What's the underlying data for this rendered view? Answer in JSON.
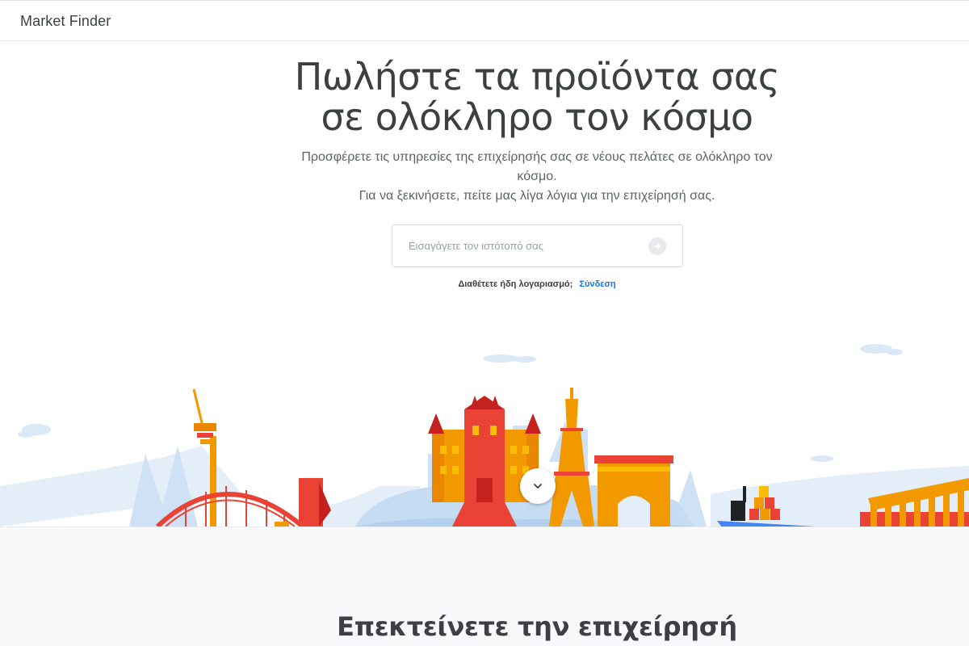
{
  "header": {
    "app_name": "Market Finder"
  },
  "hero": {
    "title_line1": "Πωλήστε τα προϊόντα σας",
    "title_line2": "σε ολόκληρο τον κόσμο",
    "subtitle_line1": "Προσφέρετε τις υπηρεσίες της επιχείρησής σας σε νέους πελάτες σε ολόκληρο τον κόσμο.",
    "subtitle_line2": "Για να ξεκινήσετε, πείτε μας λίγα λόγια για την επιχείρησή σας.",
    "url_input": {
      "value": "",
      "placeholder": "Εισαγάγετε τον ιστότοπό σας"
    },
    "submit_icon": "arrow-right-icon",
    "account_question": "Διαθέτετε ήδη λογαριασμό;",
    "signin_link": "Σύνδεση",
    "scroll_icon": "chevron-down-icon"
  },
  "section": {
    "title": "Επεκτείνετε την επιχείρησή"
  },
  "colors": {
    "accent_link": "#1a73e8",
    "text_primary": "#3c4043",
    "sky_blue": "#dbe9f7",
    "landmark_orange": "#f29900",
    "landmark_red": "#ea4335"
  }
}
